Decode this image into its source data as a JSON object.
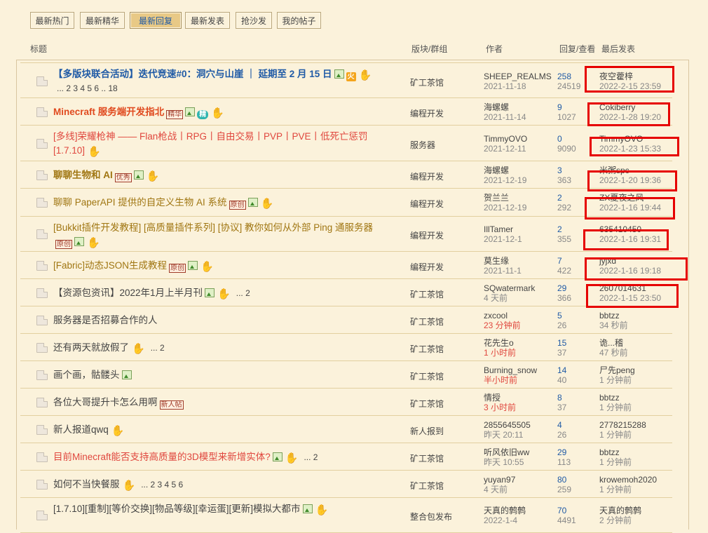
{
  "tabs": [
    {
      "label": "最新热门",
      "active": false
    },
    {
      "label": "最新精华",
      "active": false
    },
    {
      "label": "最新回复",
      "active": true
    },
    {
      "label": "最新发表",
      "active": false
    },
    {
      "label": "抢沙发",
      "active": false
    },
    {
      "label": "我的帖子",
      "active": false
    }
  ],
  "headers": {
    "title": "标题",
    "forum": "版块/群组",
    "author": "作者",
    "counts": "回复/查看",
    "last": "最后发表"
  },
  "rows": [
    {
      "title": "【多版块联合活动】迭代竞速#0：洞穴与山崖 ｜ 延期至 2 月 15 日",
      "style": "blue",
      "pages": "... 2  3  4  5  6 .. 18",
      "forum": "矿工茶馆",
      "author": "SHEEP_REALMS",
      "date": "2021-11-18",
      "replies": "258",
      "views": "24519",
      "last_user": "夜空藿梓",
      "last_time": "2022-2-15 23:59"
    },
    {
      "title": "Minecraft 服务端开发指北",
      "style": "red",
      "badge": "精华",
      "forum": "编程开发",
      "author": "海螺螺",
      "date": "2021-11-14",
      "replies": "9",
      "views": "1027",
      "last_user": "Cokiberry",
      "last_time": "2022-1-28 19:20"
    },
    {
      "title": "[多线]荣耀枪神 —— Flan枪战丨RPG丨自由交易丨PVP丨PVE丨低死亡惩罚",
      "title2": "[1.7.10]",
      "style": "pink",
      "forum": "服务器",
      "author": "TimmyOVO",
      "date": "2021-12-11",
      "replies": "0",
      "views": "9090",
      "last_user": "TimmyOVO",
      "last_time": "2022-1-23 15:33"
    },
    {
      "title": "聊聊生物和 AI",
      "style": "gold",
      "badge": "优秀",
      "forum": "编程开发",
      "author": "海螺螺",
      "date": "2021-12-19",
      "replies": "3",
      "views": "363",
      "last_user": "米粥spc",
      "last_time": "2022-1-20 19:36"
    },
    {
      "title": "聊聊 PaperAPI 提供的自定义生物 AI 系统",
      "style": "olive",
      "badge": "原创",
      "forum": "编程开发",
      "author": "贺兰兰",
      "date": "2021-12-19",
      "replies": "2",
      "views": "292",
      "last_user": "ZX夏夜之风",
      "last_time": "2022-1-16 19:44"
    },
    {
      "title": "[Bukkit插件开发教程] [高质量插件系列] [协议] 教你如何从外部 Ping 通服务器",
      "style": "olive",
      "badge": "原创",
      "forum": "编程开发",
      "author": "IllTamer",
      "date": "2021-12-1",
      "replies": "2",
      "views": "355",
      "last_user": "635410450",
      "last_time": "2022-1-16 19:31"
    },
    {
      "title": "[Fabric]动态JSON生成教程",
      "style": "olive",
      "badge": "原创",
      "forum": "编程开发",
      "author": "莫生缘",
      "date": "2021-11-1",
      "replies": "7",
      "views": "422",
      "last_user": "jyjxd",
      "last_time": "2022-1-16 19:18"
    },
    {
      "title": "【资源包资讯】2022年1月上半月刊",
      "style": "plain",
      "pages": "... 2",
      "forum": "矿工茶馆",
      "author": "SQwatermark",
      "date": "4 天前",
      "replies": "29",
      "views": "366",
      "last_user": "2607014631",
      "last_time": "2022-1-15 23:50"
    },
    {
      "title": "服务器是否招募合作的人",
      "style": "plain",
      "forum": "矿工茶馆",
      "author": "zxcool",
      "date": "23 分钟前",
      "date_red": true,
      "replies": "5",
      "views": "26",
      "last_user": "bbtzz",
      "last_time": "34 秒前"
    },
    {
      "title": "还有两天就放假了",
      "style": "plain",
      "pages": "... 2",
      "forum": "矿工茶馆",
      "author": "花先生o",
      "date": "1 小时前",
      "date_red": true,
      "replies": "15",
      "views": "37",
      "last_user": "诡...稽",
      "last_time": "47 秒前"
    },
    {
      "title": "画个画，骷髅头",
      "style": "plain",
      "forum": "矿工茶馆",
      "author": "Burning_snow",
      "date": "半小时前",
      "date_red": true,
      "replies": "14",
      "views": "40",
      "last_user": "尸先peng",
      "last_time": "1 分钟前"
    },
    {
      "title": "各位大哥提升卡怎么用啊",
      "style": "plain",
      "badge": "新人帖",
      "forum": "矿工茶馆",
      "author": "情授",
      "date": "3 小时前",
      "date_red": true,
      "replies": "8",
      "views": "37",
      "last_user": "bbtzz",
      "last_time": "1 分钟前"
    },
    {
      "title": "新人报道qwq",
      "style": "plain",
      "forum": "新人报到",
      "author": "2855645505",
      "date": "昨天 20:11",
      "replies": "4",
      "views": "26",
      "last_user": "2778215288",
      "last_time": "1 分钟前"
    },
    {
      "title": "目前Minecraft能否支持高质量的3D模型来新增实体?",
      "style": "pink",
      "pages": "... 2",
      "forum": "矿工茶馆",
      "author": "听风依旧ww",
      "date": "昨天 10:55",
      "replies": "29",
      "views": "113",
      "last_user": "bbtzz",
      "last_time": "1 分钟前"
    },
    {
      "title": "如何不当快餐服",
      "style": "plain",
      "pages": "... 2  3  4  5  6",
      "forum": "矿工茶馆",
      "author": "yuyan97",
      "date": "4 天前",
      "replies": "80",
      "views": "259",
      "last_user": "krowemoh2020",
      "last_time": "1 分钟前"
    },
    {
      "title": "[1.7.10][重制][等价交换][物品等级][幸运蛋][更新]模拟大都市",
      "style": "plain",
      "forum": "整合包发布",
      "author": "天真的鹩鹩",
      "date": "2022-1-4",
      "replies": "70",
      "views": "4491",
      "last_user": "天真的鹩鹩",
      "last_time": "2 分钟前"
    }
  ],
  "icons": {
    "hot": "火",
    "essence": "精",
    "image": "image-attachment-icon",
    "thumb": "thumb-up-icon",
    "doc": "document-icon"
  },
  "colors": {
    "background": "#fbf2db",
    "link_blue": "#1f5aa6",
    "highlight_red": "#e60000",
    "hot_title_red": "#e04a1f"
  }
}
